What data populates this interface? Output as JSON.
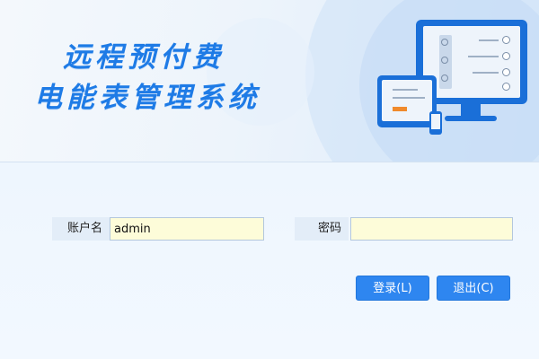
{
  "header": {
    "title_line1": "远程预付费",
    "title_line2": "电能表管理系统"
  },
  "form": {
    "username_label": "账户名",
    "username_value": "admin",
    "password_label": "密码",
    "password_value": ""
  },
  "buttons": {
    "login_label": "登录(L)",
    "exit_label": "退出(C)"
  },
  "colors": {
    "accent": "#2e86f0",
    "title": "#1e7be6",
    "input_bg": "#fdfcd9",
    "illustration_orange": "#f08a2c"
  },
  "icons": [
    "monitor-illustration",
    "tablet-illustration",
    "phone-illustration"
  ]
}
